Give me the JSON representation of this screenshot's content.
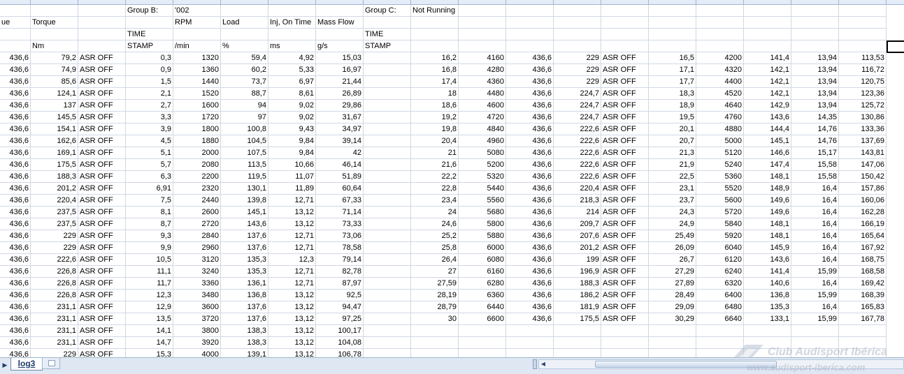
{
  "sheet": {
    "active_tab": "log3",
    "scroll_value": "III",
    "watermark_title": "Club Audisport Ibérica",
    "watermark_url": "www.audisport-iberica.com"
  },
  "header_rows": [
    [
      "",
      "",
      "",
      "Group B:",
      "'002",
      "",
      "",
      "",
      "Group C:",
      "Not Running",
      "",
      "",
      "",
      "",
      "",
      "",
      "",
      "",
      ""
    ],
    [
      "ue",
      "Torque",
      "",
      "",
      "RPM",
      "Load",
      "Inj, On Time",
      "Mass Flow",
      "",
      "",
      "",
      "",
      "",
      "",
      "",
      "",
      "",
      "",
      ""
    ],
    [
      "",
      "",
      "",
      "TIME",
      "",
      "",
      "",
      "",
      "TIME",
      "",
      "",
      "",
      "",
      "",
      "",
      "",
      "",
      "",
      ""
    ],
    [
      "",
      "Nm",
      "",
      "STAMP",
      "/min",
      "%",
      "ms",
      "g/s",
      "STAMP",
      "",
      "",
      "",
      "",
      "",
      "",
      "",
      "",
      "",
      ""
    ]
  ],
  "data_rows": [
    [
      "436,6",
      "79,2",
      "ASR OFF",
      "0,3",
      "1320",
      "59,4",
      "4,92",
      "15,03",
      "",
      "16,2",
      "4160",
      "436,6",
      "229",
      "ASR OFF",
      "16,5",
      "4200",
      "141,4",
      "13,94",
      "113,53"
    ],
    [
      "436,6",
      "74,9",
      "ASR OFF",
      "0,9",
      "1360",
      "60,2",
      "5,33",
      "16,97",
      "",
      "16,8",
      "4280",
      "436,6",
      "229",
      "ASR OFF",
      "17,1",
      "4320",
      "142,1",
      "13,94",
      "116,72"
    ],
    [
      "436,6",
      "85,6",
      "ASR OFF",
      "1,5",
      "1440",
      "73,7",
      "6,97",
      "21,44",
      "",
      "17,4",
      "4360",
      "436,6",
      "229",
      "ASR OFF",
      "17,7",
      "4400",
      "142,1",
      "13,94",
      "120,75"
    ],
    [
      "436,6",
      "124,1",
      "ASR OFF",
      "2,1",
      "1520",
      "88,7",
      "8,61",
      "26,89",
      "",
      "18",
      "4480",
      "436,6",
      "224,7",
      "ASR OFF",
      "18,3",
      "4520",
      "142,1",
      "13,94",
      "123,36"
    ],
    [
      "436,6",
      "137",
      "ASR OFF",
      "2,7",
      "1600",
      "94",
      "9,02",
      "29,86",
      "",
      "18,6",
      "4600",
      "436,6",
      "224,7",
      "ASR OFF",
      "18,9",
      "4640",
      "142,9",
      "13,94",
      "125,72"
    ],
    [
      "436,6",
      "145,5",
      "ASR OFF",
      "3,3",
      "1720",
      "97",
      "9,02",
      "31,67",
      "",
      "19,2",
      "4720",
      "436,6",
      "224,7",
      "ASR OFF",
      "19,5",
      "4760",
      "143,6",
      "14,35",
      "130,86"
    ],
    [
      "436,6",
      "154,1",
      "ASR OFF",
      "3,9",
      "1800",
      "100,8",
      "9,43",
      "34,97",
      "",
      "19,8",
      "4840",
      "436,6",
      "222,6",
      "ASR OFF",
      "20,1",
      "4880",
      "144,4",
      "14,76",
      "133,36"
    ],
    [
      "436,6",
      "162,6",
      "ASR OFF",
      "4,5",
      "1880",
      "104,5",
      "9,84",
      "39,14",
      "",
      "20,4",
      "4960",
      "436,6",
      "222,6",
      "ASR OFF",
      "20,7",
      "5000",
      "145,1",
      "14,76",
      "137,69"
    ],
    [
      "436,6",
      "169,1",
      "ASR OFF",
      "5,1",
      "2000",
      "107,5",
      "9,84",
      "42",
      "",
      "21",
      "5080",
      "436,6",
      "222,6",
      "ASR OFF",
      "21,3",
      "5120",
      "146,6",
      "15,17",
      "143,81"
    ],
    [
      "436,6",
      "175,5",
      "ASR OFF",
      "5,7",
      "2080",
      "113,5",
      "10,66",
      "46,14",
      "",
      "21,6",
      "5200",
      "436,6",
      "222,6",
      "ASR OFF",
      "21,9",
      "5240",
      "147,4",
      "15,58",
      "147,06"
    ],
    [
      "436,6",
      "188,3",
      "ASR OFF",
      "6,3",
      "2200",
      "119,5",
      "11,07",
      "51,89",
      "",
      "22,2",
      "5320",
      "436,6",
      "222,6",
      "ASR OFF",
      "22,5",
      "5360",
      "148,1",
      "15,58",
      "150,42"
    ],
    [
      "436,6",
      "201,2",
      "ASR OFF",
      "6,91",
      "2320",
      "130,1",
      "11,89",
      "60,64",
      "",
      "22,8",
      "5440",
      "436,6",
      "220,4",
      "ASR OFF",
      "23,1",
      "5520",
      "148,9",
      "16,4",
      "157,86"
    ],
    [
      "436,6",
      "220,4",
      "ASR OFF",
      "7,5",
      "2440",
      "139,8",
      "12,71",
      "67,33",
      "",
      "23,4",
      "5560",
      "436,6",
      "218,3",
      "ASR OFF",
      "23,7",
      "5600",
      "149,6",
      "16,4",
      "160,06"
    ],
    [
      "436,6",
      "237,5",
      "ASR OFF",
      "8,1",
      "2600",
      "145,1",
      "13,12",
      "71,14",
      "",
      "24",
      "5680",
      "436,6",
      "214",
      "ASR OFF",
      "24,3",
      "5720",
      "149,6",
      "16,4",
      "162,28"
    ],
    [
      "436,6",
      "237,5",
      "ASR OFF",
      "8,7",
      "2720",
      "143,6",
      "13,12",
      "73,33",
      "",
      "24,6",
      "5800",
      "436,6",
      "209,7",
      "ASR OFF",
      "24,9",
      "5840",
      "148,1",
      "16,4",
      "166,19"
    ],
    [
      "436,6",
      "229",
      "ASR OFF",
      "9,3",
      "2840",
      "137,6",
      "12,71",
      "73,06",
      "",
      "25,2",
      "5880",
      "436,6",
      "207,6",
      "ASR OFF",
      "25,49",
      "5920",
      "148,1",
      "16,4",
      "165,64"
    ],
    [
      "436,6",
      "229",
      "ASR OFF",
      "9,9",
      "2960",
      "137,6",
      "12,71",
      "78,58",
      "",
      "25,8",
      "6000",
      "436,6",
      "201,2",
      "ASR OFF",
      "26,09",
      "6040",
      "145,9",
      "16,4",
      "167,92"
    ],
    [
      "436,6",
      "222,6",
      "ASR OFF",
      "10,5",
      "3120",
      "135,3",
      "12,3",
      "79,14",
      "",
      "26,4",
      "6080",
      "436,6",
      "199",
      "ASR OFF",
      "26,7",
      "6120",
      "143,6",
      "16,4",
      "168,75"
    ],
    [
      "436,6",
      "226,8",
      "ASR OFF",
      "11,1",
      "3240",
      "135,3",
      "12,71",
      "82,78",
      "",
      "27",
      "6160",
      "436,6",
      "196,9",
      "ASR OFF",
      "27,29",
      "6240",
      "141,4",
      "15,99",
      "168,58"
    ],
    [
      "436,6",
      "226,8",
      "ASR OFF",
      "11,7",
      "3360",
      "136,1",
      "12,71",
      "87,97",
      "",
      "27,59",
      "6280",
      "436,6",
      "188,3",
      "ASR OFF",
      "27,89",
      "6320",
      "140,6",
      "16,4",
      "169,42"
    ],
    [
      "436,6",
      "226,8",
      "ASR OFF",
      "12,3",
      "3480",
      "136,8",
      "13,12",
      "92,5",
      "",
      "28,19",
      "6360",
      "436,6",
      "186,2",
      "ASR OFF",
      "28,49",
      "6400",
      "136,8",
      "15,99",
      "168,39"
    ],
    [
      "436,6",
      "231,1",
      "ASR OFF",
      "12,9",
      "3600",
      "137,6",
      "13,12",
      "94,47",
      "",
      "28,79",
      "6440",
      "436,6",
      "181,9",
      "ASR OFF",
      "29,09",
      "6480",
      "135,3",
      "16,4",
      "165,83"
    ],
    [
      "436,6",
      "231,1",
      "ASR OFF",
      "13,5",
      "3720",
      "137,6",
      "13,12",
      "97,25",
      "",
      "30",
      "6600",
      "436,6",
      "175,5",
      "ASR OFF",
      "30,29",
      "6640",
      "133,1",
      "15,99",
      "167,78"
    ],
    [
      "436,6",
      "231,1",
      "ASR OFF",
      "14,1",
      "3800",
      "138,3",
      "13,12",
      "100,17",
      "",
      "",
      "",
      "",
      "",
      "",
      "",
      "",
      "",
      "",
      ""
    ],
    [
      "436,6",
      "231,1",
      "ASR OFF",
      "14,7",
      "3920",
      "138,3",
      "13,12",
      "104,08",
      "",
      "",
      "",
      "",
      "",
      "",
      "",
      "",
      "",
      "",
      ""
    ],
    [
      "436,6",
      "229",
      "ASR OFF",
      "15,3",
      "4000",
      "139,1",
      "13,12",
      "106,78",
      "",
      "",
      "",
      "",
      "",
      "",
      "",
      "",
      "",
      "",
      ""
    ]
  ]
}
